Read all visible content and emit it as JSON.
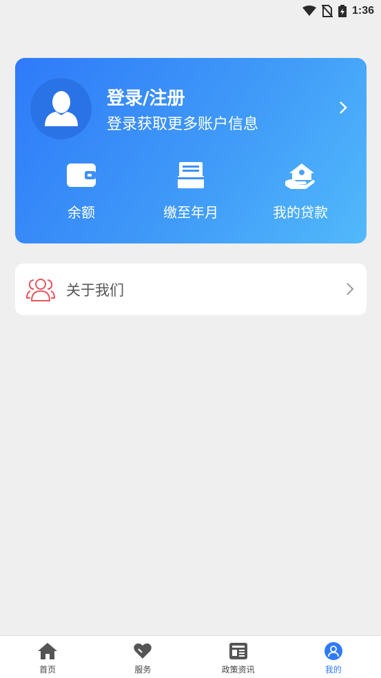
{
  "status_bar": {
    "time": "1:36"
  },
  "profile": {
    "title": "登录/注册",
    "subtitle": "登录获取更多账户信息"
  },
  "quick_actions": [
    {
      "label": "余额",
      "icon": "wallet-icon"
    },
    {
      "label": "缴至年月",
      "icon": "printer-icon"
    },
    {
      "label": "我的贷款",
      "icon": "house-loan-icon"
    }
  ],
  "menu": {
    "about": {
      "label": "关于我们",
      "icon": "people-icon"
    }
  },
  "tabbar": {
    "items": [
      {
        "label": "首页",
        "icon": "home-icon"
      },
      {
        "label": "服务",
        "icon": "heart-icon"
      },
      {
        "label": "政策资讯",
        "icon": "news-icon"
      },
      {
        "label": "我的",
        "icon": "user-icon"
      }
    ],
    "active_index": 3
  },
  "colors": {
    "accent": "#2f7af9",
    "about_icon": "#e9545c"
  }
}
